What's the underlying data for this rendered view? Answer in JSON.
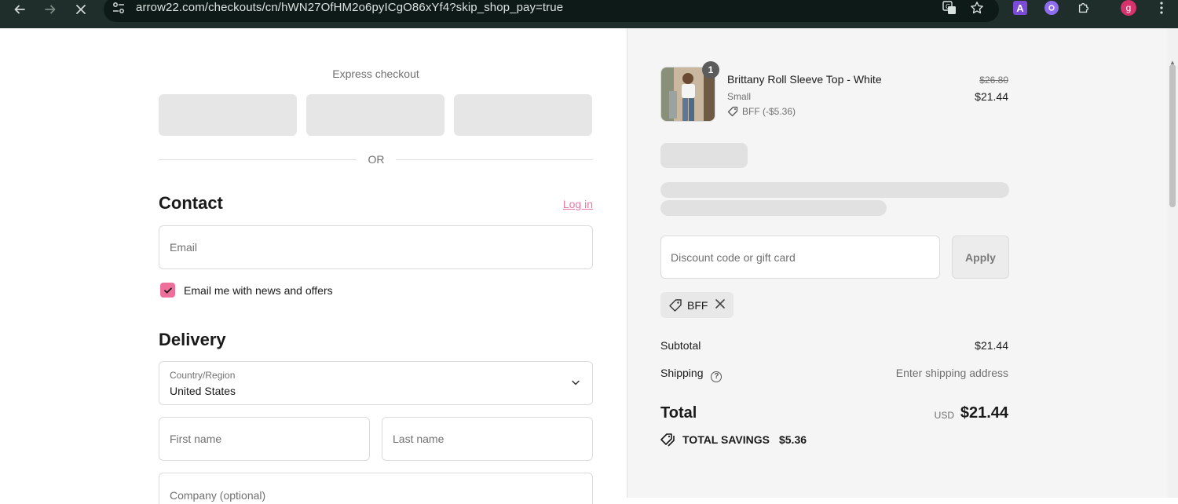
{
  "browser": {
    "url": "arrow22.com/checkouts/cn/hWN27OfHM2o6pyICgO86xYf4?skip_shop_pay=true",
    "profile_initial": "g",
    "ext_a_letter": "A"
  },
  "express": {
    "title": "Express checkout",
    "or_text": "OR"
  },
  "contact": {
    "title": "Contact",
    "login_label": "Log in",
    "email_placeholder": "Email",
    "newsletter_label": "Email me with news and offers",
    "newsletter_checked": true
  },
  "delivery": {
    "title": "Delivery",
    "country_label": "Country/Region",
    "country_value": "United States",
    "first_name_placeholder": "First name",
    "last_name_placeholder": "Last name",
    "company_placeholder": "Company (optional)"
  },
  "summary": {
    "product": {
      "name": "Brittany Roll Sleeve Top - White",
      "variant": "Small",
      "discount": "BFF (-$5.36)",
      "quantity": "1",
      "original_price": "$26.80",
      "price": "$21.44"
    },
    "discount_placeholder": "Discount code or gift card",
    "apply_label": "Apply",
    "applied_code": "BFF",
    "subtotal_label": "Subtotal",
    "subtotal_value": "$21.44",
    "shipping_label": "Shipping",
    "shipping_value": "Enter shipping address",
    "total_label": "Total",
    "currency": "USD",
    "total_value": "$21.44",
    "savings_label": "TOTAL SAVINGS",
    "savings_value": "$5.36"
  },
  "colors": {
    "accent": "#ef6f9b",
    "link": "#e879a6",
    "chrome_bg": "#1f2e2a"
  }
}
